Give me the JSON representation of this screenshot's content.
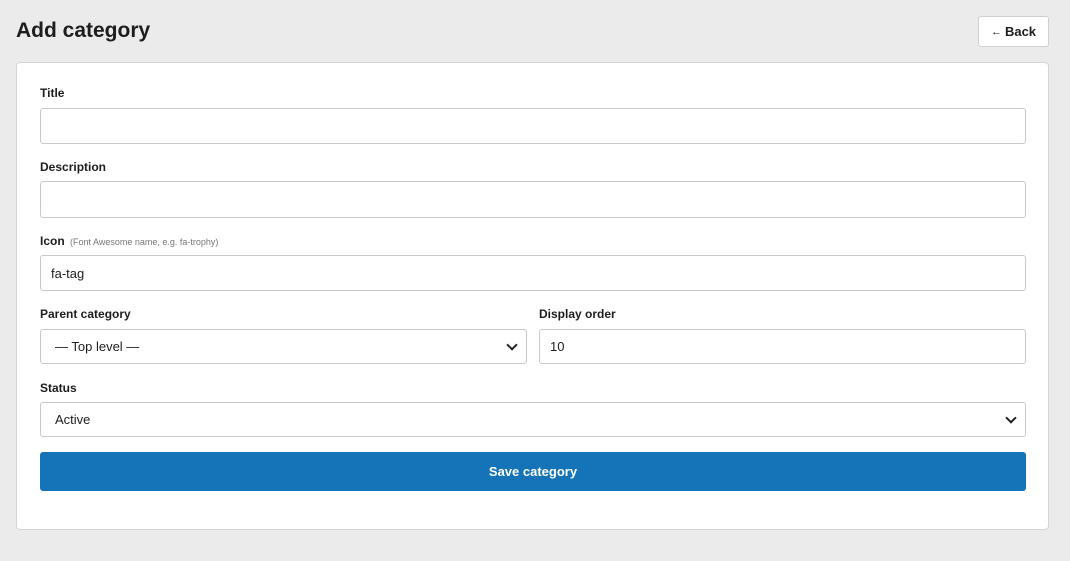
{
  "header": {
    "title": "Add category",
    "back_arrow": "←",
    "back_label": "Back"
  },
  "form": {
    "title": {
      "label": "Title",
      "value": ""
    },
    "description": {
      "label": "Description",
      "value": ""
    },
    "icon": {
      "label": "Icon",
      "hint": "(Font Awesome name, e.g. fa-trophy)",
      "value": "fa-tag"
    },
    "parent_category": {
      "label": "Parent category",
      "selected": "— Top level —"
    },
    "display_order": {
      "label": "Display order",
      "value": "10"
    },
    "status": {
      "label": "Status",
      "selected": "Active"
    },
    "submit_label": "Save category"
  },
  "colors": {
    "page_background": "#ebebeb",
    "primary_button": "#1574b8"
  }
}
